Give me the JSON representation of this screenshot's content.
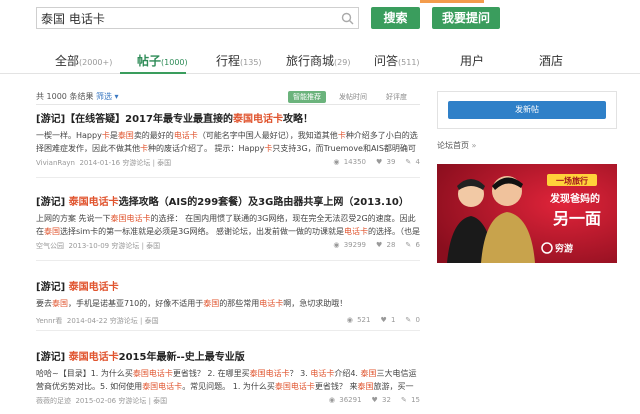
{
  "search": {
    "value": "泰国 电话卡",
    "button": "搜索",
    "ask_button": "我要提问"
  },
  "tabs": [
    {
      "label": "全部",
      "count": "(2000+)"
    },
    {
      "label": "帖子",
      "count": "(1000)"
    },
    {
      "label": "行程",
      "count": "(135)"
    },
    {
      "label": "旅行商城",
      "count": "(29)"
    },
    {
      "label": "问答",
      "count": "(511)"
    },
    {
      "label": "用户",
      "count": ""
    },
    {
      "label": "酒店",
      "count": ""
    }
  ],
  "list_header": {
    "total": "共 1000 条结果",
    "filter": "筛选 ▾",
    "sort": [
      "智能推荐",
      "发帖时间",
      "好评度"
    ]
  },
  "posts": [
    {
      "title": [
        "[游记]【在线答疑】2017年最专业最直接的",
        "泰国电话卡",
        "攻略！"
      ],
      "excerpt": [
        "一楔一样。Happy",
        "卡",
        "是",
        "泰国",
        "卖的最好的",
        "电话卡",
        "（可能名字中国人最好记），我知道其他",
        "卡",
        "种介绍多了小白的选择困难症发作，因此不做其他",
        "卡",
        "种的废话介绍了。 提示：Happy",
        "卡",
        "只支持3G，而Truemove和AIS都明确可以支持"
      ],
      "author": "VivianRayn",
      "meta": "2014-01-16 穷游论坛 | 泰国",
      "views": "14350",
      "likes": "39",
      "replies": "4"
    },
    {
      "title": [
        "[游记] ",
        "泰国电话卡",
        "选择攻略（AIS的299套餐）及3G路由器共享上网（2013.10）"
      ],
      "excerpt": [
        "上网的方案 先说一下",
        "泰国电话卡",
        "的选择： 在国内用惯了联通的3G网络，现在完全无法忍受2G的速度。因此在",
        "泰国",
        "选择sim卡的第一标准就是必须是3G网络。 感谢论坛，出发前做一做的功课就是",
        "电话卡",
        "的选择。（也是惯"
      ],
      "author": "空气公园",
      "meta": "2013-10-09 穷游论坛 | 泰国",
      "views": "39299",
      "likes": "28",
      "replies": "6"
    },
    {
      "title": [
        "[游记] ",
        "泰国电话卡",
        ""
      ],
      "excerpt": [
        "要去",
        "泰国",
        "，手机是诺基亚710的，好像不适用于",
        "泰国",
        "的那些常用",
        "电话卡",
        "啊，急切求助哦！"
      ],
      "author": "Yennr看",
      "meta": "2014-04-22 穷游论坛 | 泰国",
      "views": "521",
      "likes": "1",
      "replies": "0"
    },
    {
      "title": [
        "[游记] ",
        "泰国电话卡",
        "2015年最新--史上最专业版"
      ],
      "excerpt": [
        "哈哈~【目录】1. 为什么买",
        "泰国电话卡",
        "更省钱？ 2. 在哪里买",
        "泰国电话卡",
        "？ 3. ",
        "电话卡",
        "介绍4. ",
        "泰国",
        "三大电信运营商优劣势对比。5. 如何使用",
        "泰国电话卡",
        "。常见问题。 1. 为什么买",
        "泰国电话卡",
        "更省钱？ 来",
        "泰国",
        "旅游，买一张当地",
        "电"
      ],
      "author": "薇薇的足迹",
      "meta": "2015-02-06 穷游论坛 | 泰国",
      "views": "36291",
      "likes": "32",
      "replies": "15"
    }
  ],
  "sidebar": {
    "post_button": "发新帖",
    "forum_link": "论坛首页",
    "forum_arrow": "»",
    "banner_badge": "一场旅行",
    "banner_line1": "发现爸妈的",
    "banner_line2": "另一面",
    "banner_logo": "穷游"
  },
  "colors": {
    "green": "#3a9d5d",
    "blue": "#2f80c8",
    "keyword": "#e0542e",
    "banner_red": "#c8102e"
  }
}
